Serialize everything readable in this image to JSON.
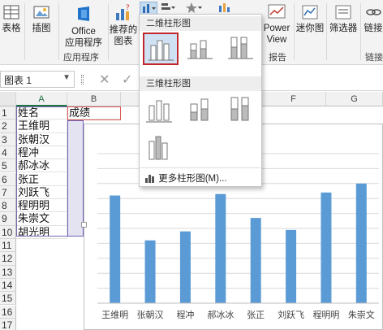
{
  "ribbon": {
    "table_label": "表格",
    "illustrations_label": "插图",
    "office_label": "Office",
    "apps_label": "应用程序",
    "apps_group": "应用程序",
    "recommended_label": "推荐的",
    "recommended_label2": "图表",
    "powerview_label": "Power",
    "powerview_label2": "View",
    "report_group": "报告",
    "sparklines_label": "迷你图",
    "filter_label": "筛选器",
    "link_label": "链接",
    "link_group": "链接"
  },
  "formula_bar": {
    "name_box": "图表 1"
  },
  "sheet": {
    "columns": [
      "A",
      "B",
      "F",
      "G"
    ],
    "rows": [
      "1",
      "2",
      "3",
      "4",
      "5",
      "6",
      "7",
      "8",
      "9",
      "10",
      "11",
      "12",
      "13",
      "14",
      "15",
      "16",
      "17"
    ],
    "header_name": "姓名",
    "header_score": "成绩",
    "names": [
      "王维明",
      "张朝汉",
      "程冲",
      "郝冰冰",
      "张正",
      "刘跃飞",
      "程明明",
      "朱崇文",
      "胡光明"
    ]
  },
  "dropdown": {
    "section_2d": "二维柱形图",
    "section_3d": "三维柱形图",
    "more_charts": "更多柱形图(M)..."
  },
  "chart_data": {
    "type": "bar",
    "categories": [
      "王维明",
      "张朝汉",
      "程冲",
      "郝冰冰",
      "张正",
      "刘跃飞",
      "程明明",
      "朱崇文"
    ],
    "values": [
      72,
      42,
      48,
      73,
      57,
      49,
      74,
      80
    ],
    "ylim": [
      0,
      100
    ],
    "grid": true,
    "bar_color": "#5b9bd5"
  }
}
